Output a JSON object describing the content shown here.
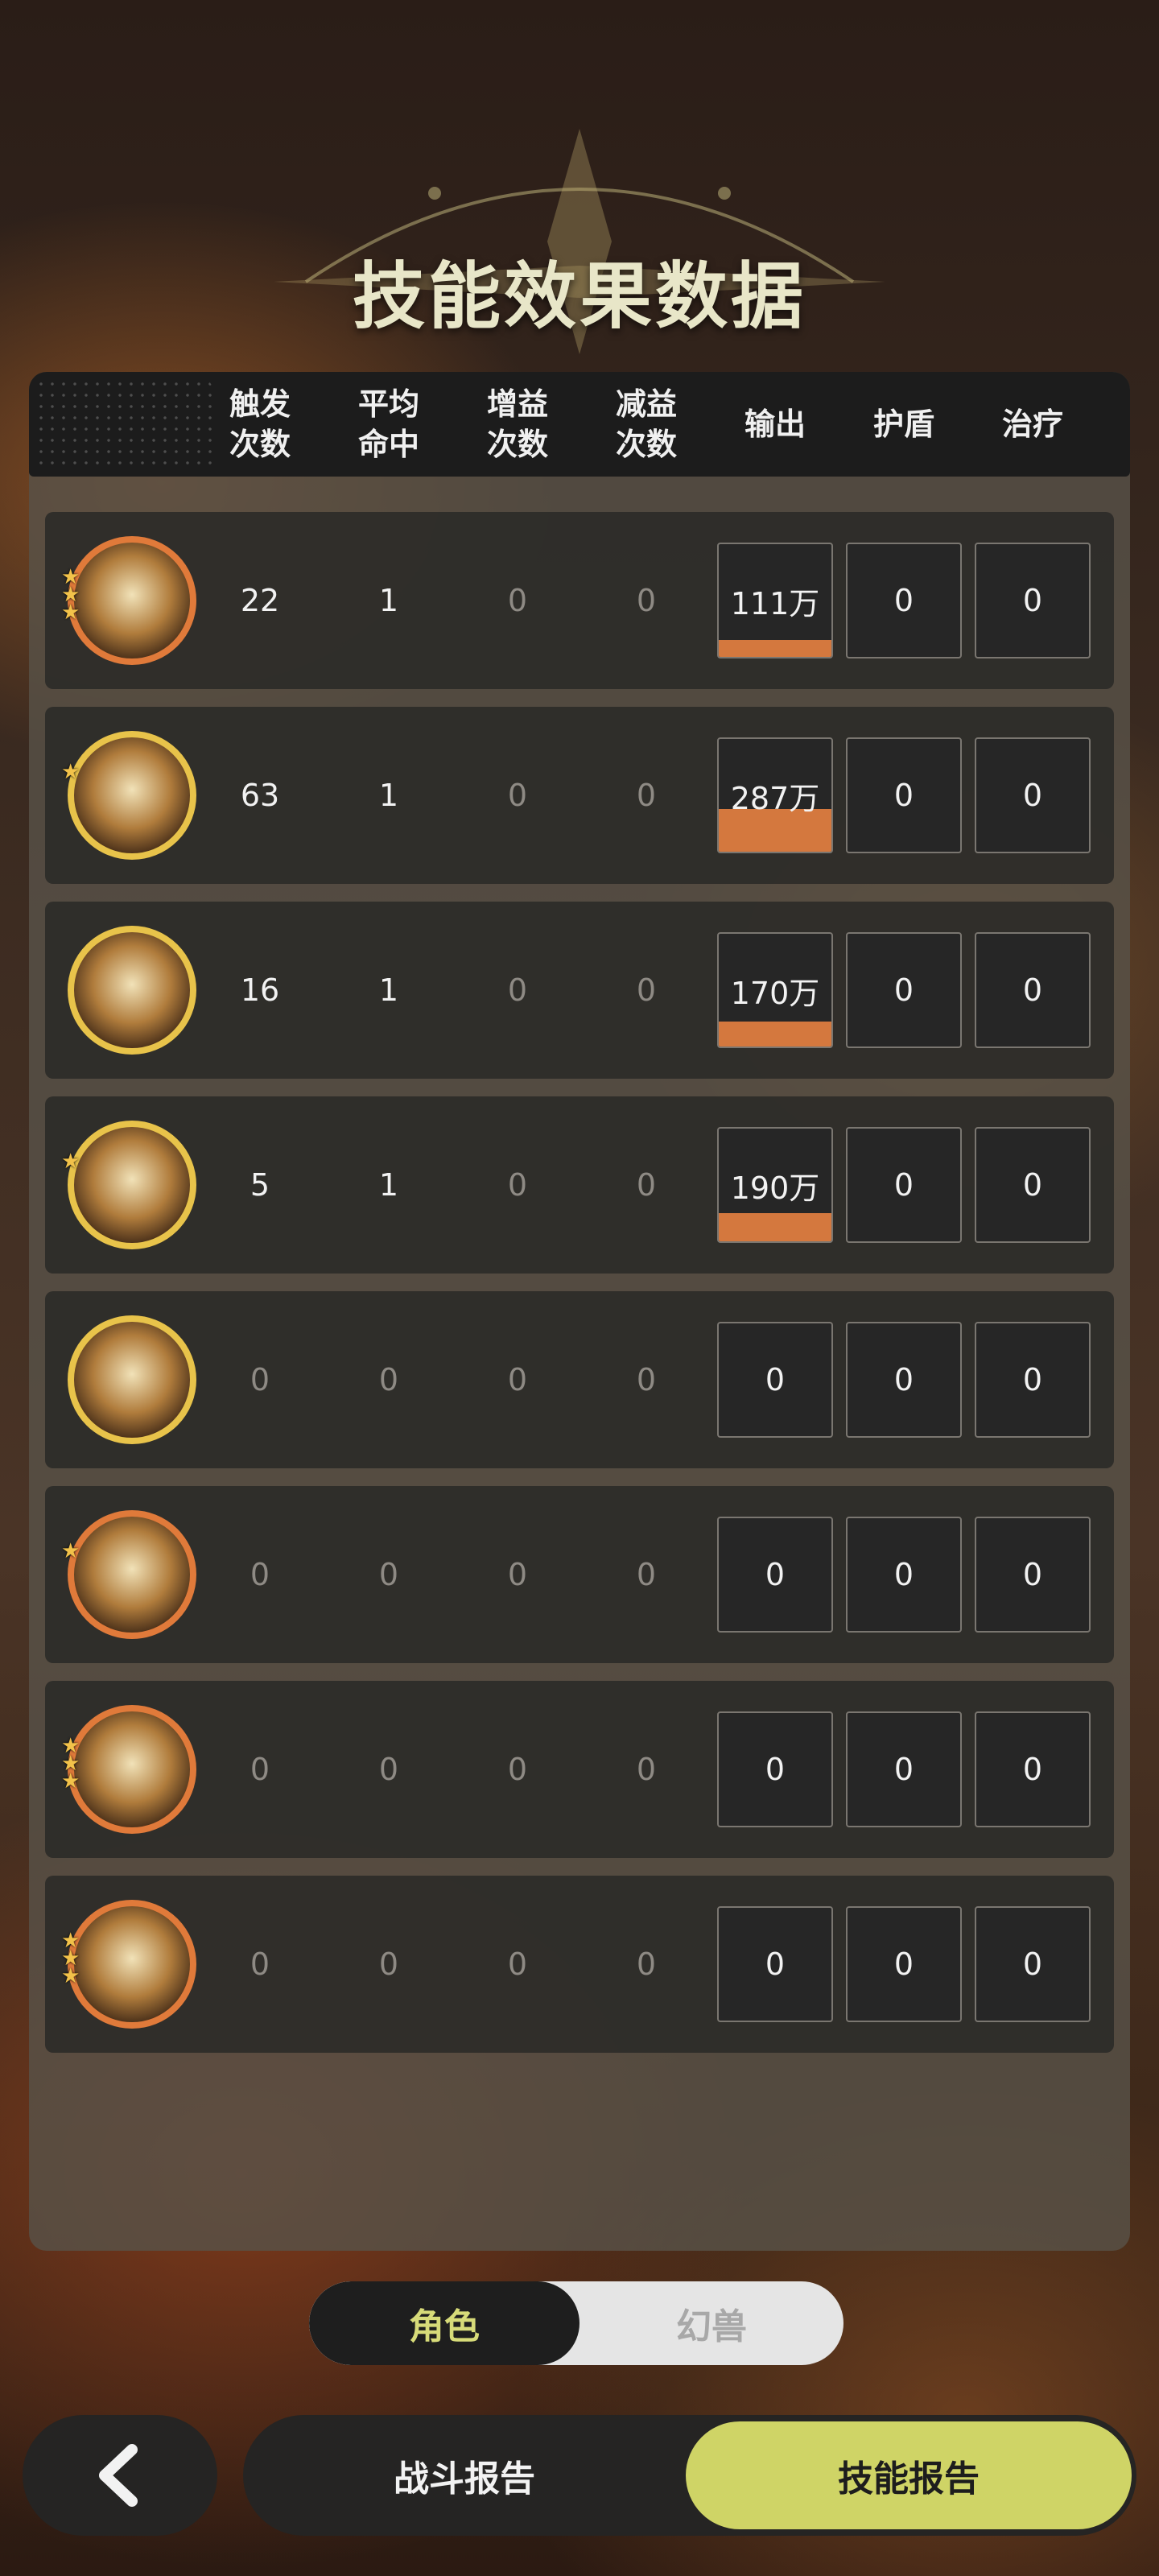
{
  "title": "技能效果数据",
  "columns": {
    "triggers": "触发\n次数",
    "avg_hit": "平均\n命中",
    "buff_count": "增益\n次数",
    "debuff_count": "减益\n次数",
    "output": "输出",
    "shield": "护盾",
    "heal": "治疗"
  },
  "rows": [
    {
      "icon": "flame-slash-skill-icon",
      "stars": 3,
      "ring": "#e07a3a",
      "triggers": "22",
      "avg_hit": "1",
      "buff": "0",
      "debuff": "0",
      "output": "111万",
      "output_fill": 0.15,
      "shield": "0",
      "heal": "0"
    },
    {
      "icon": "fire-burst-skill-icon",
      "stars": 1,
      "ring": "#e8c34a",
      "triggers": "63",
      "avg_hit": "1",
      "buff": "0",
      "debuff": "0",
      "output": "287万",
      "output_fill": 0.38,
      "shield": "0",
      "heal": "0"
    },
    {
      "icon": "lightning-slash-skill-icon",
      "stars": 0,
      "ring": "#e8c34a",
      "triggers": "16",
      "avg_hit": "1",
      "buff": "0",
      "debuff": "0",
      "output": "170万",
      "output_fill": 0.22,
      "shield": "0",
      "heal": "0"
    },
    {
      "icon": "sword-strike-skill-icon",
      "stars": 1,
      "ring": "#e8c34a",
      "triggers": "5",
      "avg_hit": "1",
      "buff": "0",
      "debuff": "0",
      "output": "190万",
      "output_fill": 0.25,
      "shield": "0",
      "heal": "0"
    },
    {
      "icon": "eye-skill-icon",
      "stars": 0,
      "ring": "#e8c34a",
      "triggers": "0",
      "avg_hit": "0",
      "buff": "0",
      "debuff": "0",
      "output": "0",
      "output_fill": 0,
      "shield": "0",
      "heal": "0"
    },
    {
      "icon": "vortex-target-skill-icon",
      "stars": 1,
      "ring": "#e07a3a",
      "triggers": "0",
      "avg_hit": "0",
      "buff": "0",
      "debuff": "0",
      "output": "0",
      "output_fill": 0,
      "shield": "0",
      "heal": "0"
    },
    {
      "icon": "sword-arrows-skill-icon",
      "stars": 3,
      "ring": "#e07a3a",
      "triggers": "0",
      "avg_hit": "0",
      "buff": "0",
      "debuff": "0",
      "output": "0",
      "output_fill": 0,
      "shield": "0",
      "heal": "0"
    },
    {
      "icon": "sword-down-skill-icon",
      "stars": 3,
      "ring": "#e07a3a",
      "triggers": "0",
      "avg_hit": "0",
      "buff": "0",
      "debuff": "0",
      "output": "0",
      "output_fill": 0,
      "shield": "0",
      "heal": "0"
    }
  ],
  "toggle": {
    "character": "角色",
    "beast": "幻兽",
    "selected": "character"
  },
  "bottom": {
    "battle_report": "战斗报告",
    "skill_report": "技能报告",
    "selected": "skill_report"
  },
  "colors": {
    "accent": "#cfd466",
    "output_bar": "#d4783e"
  }
}
